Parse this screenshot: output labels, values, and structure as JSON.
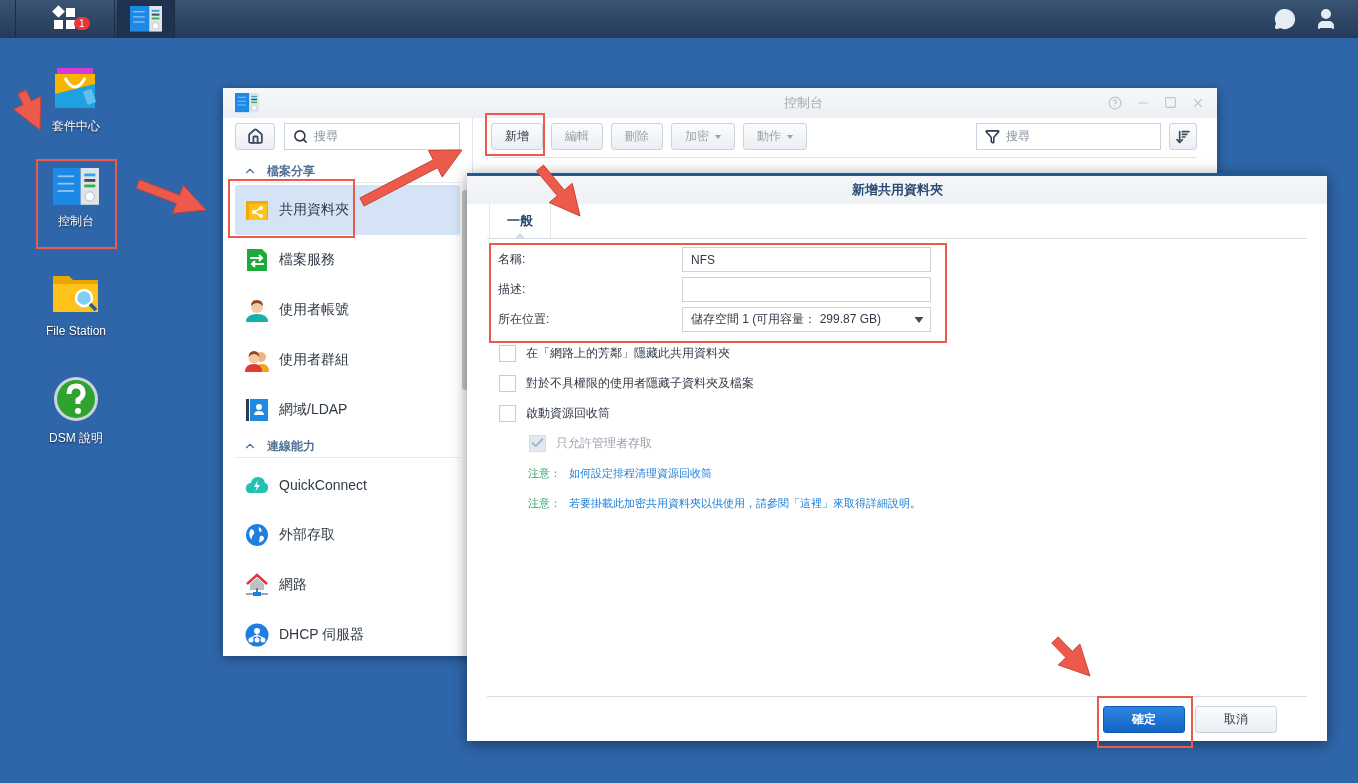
{
  "taskbar": {
    "buttons": [
      {
        "kind": "main-menu",
        "badge": "1"
      },
      {
        "kind": "control-panel"
      }
    ],
    "tray": [
      {
        "kind": "chat"
      },
      {
        "kind": "user"
      }
    ]
  },
  "desktop_icons": [
    {
      "kind": "package-center",
      "label": "套件中心",
      "highlighted": false
    },
    {
      "kind": "control-panel",
      "label": "控制台",
      "highlighted": true
    },
    {
      "kind": "file-station",
      "label": "File Station",
      "highlighted": false
    },
    {
      "kind": "help",
      "label": "DSM 說明",
      "highlighted": false
    }
  ],
  "control_panel": {
    "title": "控制台",
    "search": {
      "placeholder": "搜尋"
    },
    "sidebar": [
      {
        "title": "檔案分享",
        "expanded": true,
        "items": [
          {
            "kind": "shared-folder",
            "label": "共用資料夾",
            "selected": true,
            "highlighted": true
          },
          {
            "kind": "file-services",
            "label": "檔案服務",
            "selected": false,
            "highlighted": false
          },
          {
            "kind": "user",
            "label": "使用者帳號",
            "selected": false,
            "highlighted": false
          },
          {
            "kind": "group",
            "label": "使用者群組",
            "selected": false,
            "highlighted": false
          },
          {
            "kind": "directory",
            "label": "網域/LDAP",
            "selected": false,
            "highlighted": false
          }
        ]
      },
      {
        "title": "連線能力",
        "expanded": true,
        "items": [
          {
            "kind": "quickconnect",
            "label": "QuickConnect",
            "selected": false,
            "highlighted": false
          },
          {
            "kind": "globe",
            "label": "外部存取",
            "selected": false,
            "highlighted": false
          },
          {
            "kind": "network",
            "label": "網路",
            "selected": false,
            "highlighted": false
          },
          {
            "kind": "dhcp",
            "label": "DHCP 伺服器",
            "selected": false,
            "highlighted": false
          }
        ]
      }
    ],
    "toolbar": [
      {
        "label": "新增",
        "dropdown": false,
        "disabled": false,
        "highlighted": true
      },
      {
        "label": "編輯",
        "dropdown": false,
        "disabled": true,
        "highlighted": false
      },
      {
        "label": "刪除",
        "dropdown": false,
        "disabled": true,
        "highlighted": false
      },
      {
        "label": "加密",
        "dropdown": true,
        "disabled": true,
        "highlighted": false
      },
      {
        "label": "動作",
        "dropdown": true,
        "disabled": true,
        "highlighted": false
      }
    ],
    "filter": {
      "placeholder": "搜尋"
    }
  },
  "dialog": {
    "title": "新增共用資料夾",
    "tabs": [
      {
        "label": "一般",
        "selected": true
      }
    ],
    "highlighted_fields": true,
    "fields": [
      {
        "label": "名稱:",
        "kind": "text",
        "value": "NFS"
      },
      {
        "label": "描述:",
        "kind": "text"
      },
      {
        "label": "所在位置:",
        "kind": "select",
        "value": "儲存空間 1 (可用容量： 299.87 GB)"
      }
    ],
    "options": [
      {
        "label": "在「網路上的芳鄰」隱藏此共用資料夾",
        "checked": false,
        "disabled": false
      },
      {
        "label": "對於不具權限的使用者隱藏子資料夾及檔案",
        "checked": false,
        "disabled": false
      },
      {
        "label": "啟動資源回收筒",
        "checked": false,
        "disabled": false,
        "children": [
          {
            "label": "只允許管理者存取",
            "checked": true,
            "disabled": true
          }
        ]
      }
    ],
    "notes": [
      {
        "prefix": "注意：",
        "text": "如何設定排程清理資源回收筒"
      },
      {
        "prefix": "注意：",
        "text": "若要掛載此加密共用資料夾以供使用，請參閱「這裡」來取得詳細說明。"
      }
    ],
    "buttons": [
      {
        "label": "確定",
        "kind": "primary",
        "highlighted": true
      },
      {
        "label": "取消",
        "kind": "secondary",
        "highlighted": false
      }
    ]
  }
}
